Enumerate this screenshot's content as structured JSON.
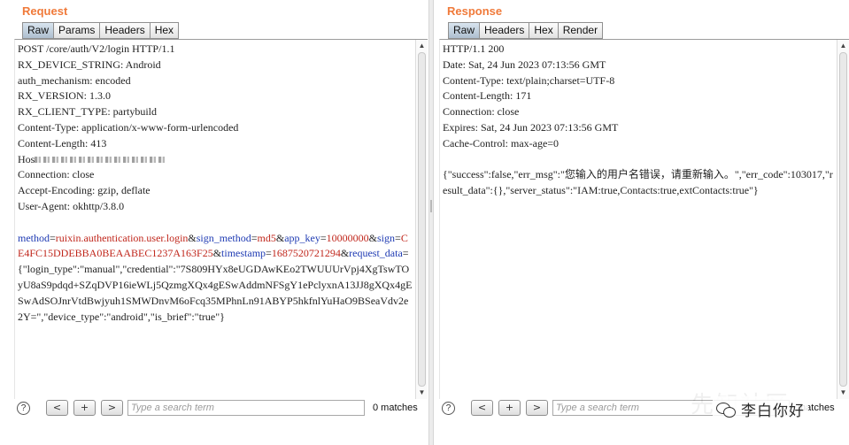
{
  "request": {
    "title": "Request",
    "tabs": [
      "Raw",
      "Params",
      "Headers",
      "Hex"
    ],
    "lines": [
      "POST /core/auth/V2/login HTTP/1.1",
      "RX_DEVICE_STRING: Android",
      "auth_mechanism: encoded",
      "RX_VERSION: 1.3.0",
      "RX_CLIENT_TYPE: partybuild",
      "Content-Type: application/x-www-form-urlencoded",
      "Content-Length: 413",
      "Hos",
      "Connection: close",
      "Accept-Encoding: gzip, deflate",
      "User-Agent: okhttp/3.8.0"
    ],
    "body_params": [
      {
        "key": "method",
        "value": "ruixin.authentication.user.login"
      },
      {
        "key": "sign_method",
        "value": "md5"
      },
      {
        "key": "app_key",
        "value": "10000000"
      },
      {
        "key": "sign",
        "value": "CE4FC15DDEBBA0BEAABEC1237A163F25"
      },
      {
        "key": "timestamp",
        "value": "1687520721294"
      },
      {
        "key": "request_data",
        "value": "{\"login_type\":\"manual\",\"credential\":\"7S809HYx8eUGDAwKEo2TWUUUrVpj4XgTswTOyU8aS9pdqd+SZqDVP16ieWLj5QzmgXQx4gESwAddmNFSgY1ePclyxnA13JJ8gXQx4gESwAdSOJnrVtdBwjyuh1SMWDnvM6oFcq35MPhnLn91ABYP5hkfnlYuHaO9BSeaVdv2e2Y=\",\"device_type\":\"android\",\"is_brief\":\"true\"}"
      }
    ],
    "search": {
      "placeholder": "Type a search term",
      "matches": "0 matches"
    }
  },
  "response": {
    "title": "Response",
    "tabs": [
      "Raw",
      "Headers",
      "Hex",
      "Render"
    ],
    "lines": [
      "HTTP/1.1 200",
      "Date: Sat, 24 Jun 2023 07:13:56 GMT",
      "Content-Type: text/plain;charset=UTF-8",
      "Content-Length: 171",
      "Connection: close",
      "Expires: Sat, 24 Jun 2023 07:13:56 GMT",
      "Cache-Control: max-age=0"
    ],
    "body": "{\"success\":false,\"err_msg\":\"您输入的用户名错误，请重新输入。\",\"err_code\":103017,\"result_data\":{},\"server_status\":\"IAM:true,Contacts:true,extContacts:true\"}",
    "search": {
      "placeholder": "Type a search term",
      "matches": "matches"
    }
  },
  "controls": {
    "help": "?",
    "prev": "<",
    "add": "+",
    "next": ">"
  },
  "watermark": {
    "text": "李白你好",
    "background_text": "先知社区"
  },
  "colors": {
    "title": "#f07a3a",
    "param_key": "#1f3bb3",
    "param_value": "#c0261b",
    "active_tab": "#aebfcf"
  }
}
